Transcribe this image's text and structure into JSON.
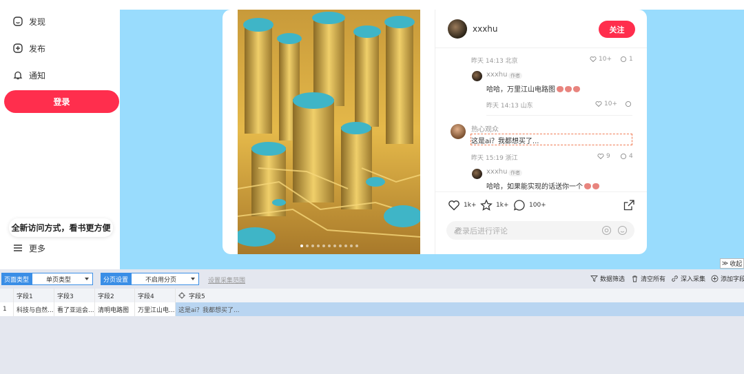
{
  "sidebar": {
    "items": [
      {
        "label": "发现",
        "icon": "discover-icon"
      },
      {
        "label": "发布",
        "icon": "publish-plus-icon"
      },
      {
        "label": "通知",
        "icon": "bell-icon"
      }
    ],
    "login_label": "登录",
    "tip": "全新访问方式，看书更方便",
    "more_label": "更多"
  },
  "post": {
    "carousel_count": 11,
    "carousel_active": 0,
    "author": {
      "name": "xxxhu"
    },
    "follow_label": "关注",
    "comments": [
      {
        "meta": "昨天 14:13 北京",
        "likes": "10+",
        "replies": "1"
      },
      {
        "user": "xxxhu",
        "badge": "作者",
        "text": "哈哈，万里江山电路图",
        "meta": "昨天 14:13 山东",
        "likes": "10+"
      },
      {
        "user": "热心观众",
        "text": "这是ai？我都想买了...",
        "meta": "昨天 15:19 浙江",
        "likes": "9",
        "replies": "4"
      },
      {
        "user": "xxxhu",
        "badge": "作者",
        "text": "哈哈，如果能实现的话送你一个"
      }
    ],
    "actions": {
      "like": "1k+",
      "collect": "1k+",
      "comment": "100+"
    },
    "comment_placeholder": "登录后进行评论"
  },
  "scraper": {
    "collapse_label": "收起",
    "page_type_label": "页面类型",
    "page_type_value": "单页类型",
    "paging_label": "分页设置",
    "paging_value": "不启用分页",
    "range_link": "设置采集范围",
    "actions": [
      "数据筛选",
      "清空所有",
      "深入采集",
      "添加字段"
    ],
    "columns": [
      "字段1",
      "字段3",
      "字段2",
      "字段4",
      "字段5"
    ],
    "rows": [
      {
        "index": "1",
        "cells": [
          "科技与自然...",
          "看了亚运会...",
          "清明电路图",
          "万里江山电...",
          "这是ai？我都想买了..."
        ]
      }
    ]
  }
}
